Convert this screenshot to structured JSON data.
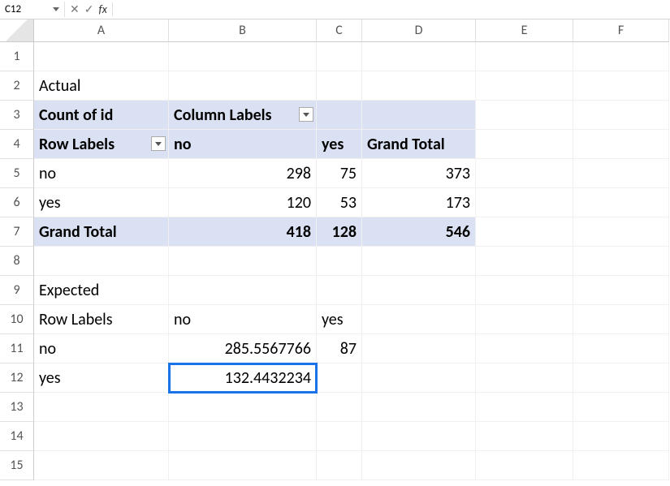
{
  "formula_bar": {
    "name_box": "C12",
    "cancel_icon": "✕",
    "confirm_icon": "✓",
    "fx_label": "fx",
    "formula": ""
  },
  "columns": [
    "A",
    "B",
    "C",
    "D",
    "E",
    "F"
  ],
  "row_numbers": [
    "1",
    "2",
    "3",
    "4",
    "5",
    "6",
    "7",
    "8",
    "9",
    "10",
    "11",
    "12",
    "13",
    "14",
    "15"
  ],
  "cells": {
    "A2": "Actual",
    "A3": "Count of id",
    "B3": "Column Labels",
    "A4": "Row Labels",
    "B4": "no",
    "C4": "yes",
    "D4": "Grand Total",
    "A5": "no",
    "B5": "298",
    "C5": "75",
    "D5": "373",
    "A6": "yes",
    "B6": "120",
    "C6": "53",
    "D6": "173",
    "A7": "Grand Total",
    "B7": "418",
    "C7": "128",
    "D7": "546",
    "A9": "Expected",
    "A10": "Row Labels",
    "B10": "no",
    "C10": "yes",
    "A11": "no",
    "B11": "285.5567766",
    "C11": "87",
    "A12": "yes",
    "B12": "132.4432234"
  },
  "chart_data": [
    {
      "type": "table",
      "title": "Actual — Count of id",
      "row_labels": [
        "no",
        "yes",
        "Grand Total"
      ],
      "column_labels": [
        "no",
        "yes",
        "Grand Total"
      ],
      "values": [
        [
          298,
          75,
          373
        ],
        [
          120,
          53,
          173
        ],
        [
          418,
          128,
          546
        ]
      ]
    },
    {
      "type": "table",
      "title": "Expected",
      "row_labels": [
        "no",
        "yes"
      ],
      "column_labels": [
        "no",
        "yes"
      ],
      "values": [
        [
          285.5567766,
          87
        ],
        [
          132.4432234,
          null
        ]
      ]
    }
  ]
}
